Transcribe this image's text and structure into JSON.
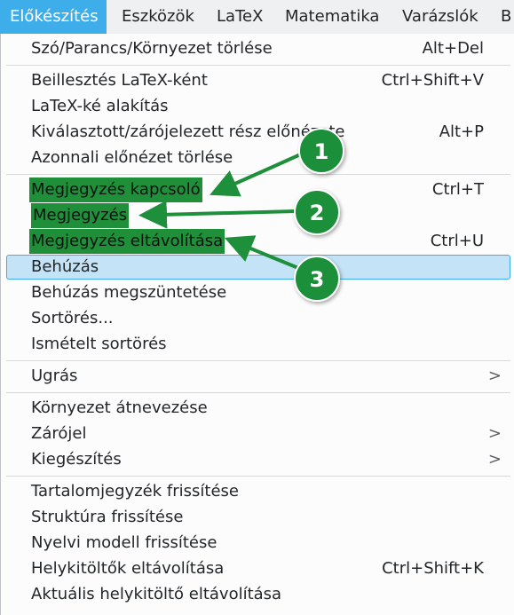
{
  "menubar": {
    "items": [
      {
        "label": "Előkészítés",
        "active": true
      },
      {
        "label": "Eszközök"
      },
      {
        "label": "LaTeX"
      },
      {
        "label": "Matematika"
      },
      {
        "label": "Varázslók"
      },
      {
        "label": "B"
      }
    ]
  },
  "menu": {
    "items": [
      {
        "label": "Szó/Parancs/Környezet törlése",
        "shortcut": "Alt+Del"
      },
      {
        "label": "Beillesztés LaTeX-ként",
        "shortcut": "Ctrl+Shift+V"
      },
      {
        "label": "LaTeX-ké alakítás",
        "shortcut": ""
      },
      {
        "label": "Kiválasztott/zárójelezett rész előnézete",
        "shortcut": "Alt+P"
      },
      {
        "label": "Azonnali előnézet törlése",
        "shortcut": ""
      },
      {
        "label": "Megjegyzés kapcsoló",
        "shortcut": "Ctrl+T"
      },
      {
        "label": "Megjegyzés",
        "shortcut": ""
      },
      {
        "label": "Megjegyzés eltávolítása",
        "shortcut": "Ctrl+U"
      },
      {
        "label": "Behúzás",
        "shortcut": ""
      },
      {
        "label": "Behúzás megszüntetése",
        "shortcut": ""
      },
      {
        "label": "Sortörés...",
        "shortcut": ""
      },
      {
        "label": "Ismételt sortörés",
        "shortcut": ""
      },
      {
        "label": "Ugrás",
        "submenu": ">"
      },
      {
        "label": "Környezet átnevezése",
        "shortcut": ""
      },
      {
        "label": "Zárójel",
        "submenu": ">"
      },
      {
        "label": "Kiegészítés",
        "submenu": ">"
      },
      {
        "label": "Tartalomjegyzék frissítése",
        "shortcut": ""
      },
      {
        "label": "Struktúra frissítése",
        "shortcut": ""
      },
      {
        "label": "Nyelvi modell frissítése",
        "shortcut": ""
      },
      {
        "label": "Helykitöltők eltávolítása",
        "shortcut": "Ctrl+Shift+K"
      },
      {
        "label": "Aktuális helykitöltő eltávolítása",
        "shortcut": ""
      }
    ]
  },
  "annotations": {
    "badges": [
      "1",
      "2",
      "3"
    ],
    "color": "#1e8f3a"
  }
}
